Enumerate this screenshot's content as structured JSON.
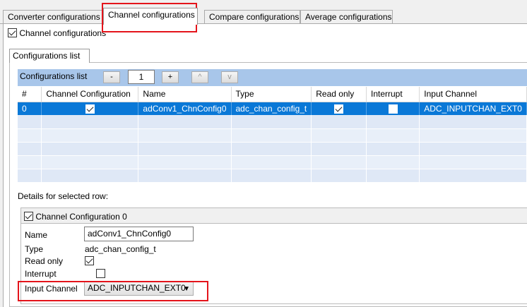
{
  "tabs": [
    {
      "label": "Converter configurations"
    },
    {
      "label": "Channel configurations"
    },
    {
      "label": "Compare configurations"
    },
    {
      "label": "Average configurations"
    }
  ],
  "channel_enable": {
    "label": "Channel configurations",
    "checked": true
  },
  "config_group": {
    "title": "Configurations list"
  },
  "list_header": {
    "title": "Configurations list",
    "minus": "-",
    "count": "1",
    "plus": "+",
    "up": "^",
    "down": "v"
  },
  "table": {
    "columns": [
      "#",
      "Channel Configuration",
      "Name",
      "Type",
      "Read only",
      "Interrupt",
      "Input Channel"
    ],
    "rows": [
      {
        "index": "0",
        "channel_configuration": true,
        "name": "adConv1_ChnConfig0",
        "type": "adc_chan_config_t",
        "read_only": true,
        "interrupt": false,
        "input_channel": "ADC_INPUTCHAN_EXT0"
      }
    ]
  },
  "details": {
    "title": "Details for selected row:",
    "group_title": "Channel Configuration 0",
    "name_label": "Name",
    "name_value": "adConv1_ChnConfig0",
    "type_label": "Type",
    "type_value": "adc_chan_config_t",
    "readonly_label": "Read only",
    "interrupt_label": "Interrupt",
    "input_label": "Input Channel",
    "input_value": "ADC_INPUTCHAN_EXT0"
  },
  "colors": {
    "selection": "#0a78d7",
    "highlight": "#e4141b",
    "header_bar": "#a8c6ea"
  }
}
